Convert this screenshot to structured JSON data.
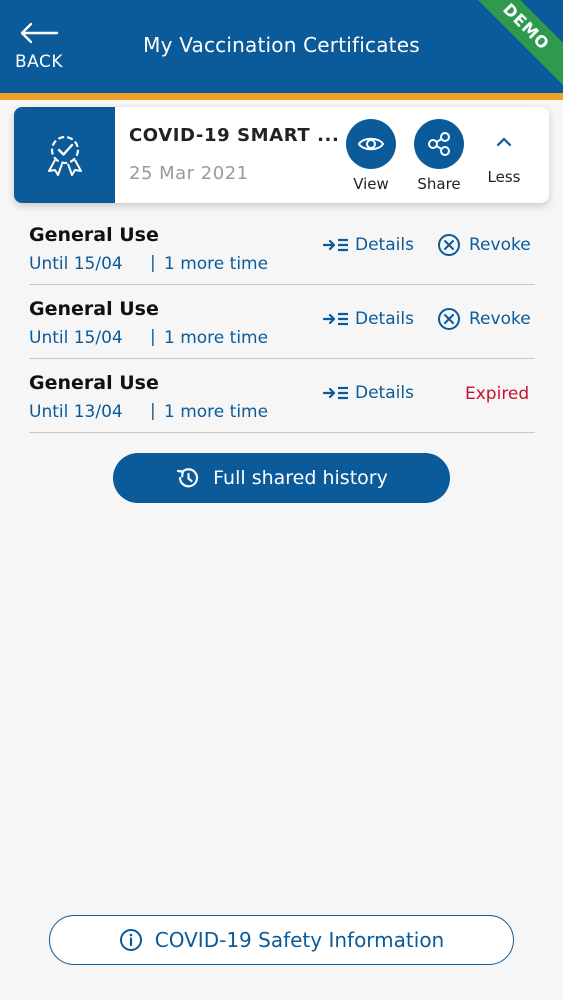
{
  "header": {
    "back_label": "BACK",
    "title": "My Vaccination Certificates",
    "ribbon": "DEMO"
  },
  "colors": {
    "primary": "#0b5a9a",
    "accent_bar": "#f0a125",
    "ribbon": "#2f9a4e",
    "expired": "#c8102e"
  },
  "certificate": {
    "name": "COVID-19 SMART ...",
    "date": "25 Mar 2021",
    "badge_icon": "certificate-badge-icon",
    "actions": {
      "view_label": "View",
      "share_label": "Share",
      "less_label": "Less"
    }
  },
  "shares": [
    {
      "purpose": "General Use",
      "until": "Until 15/04",
      "separator": "|",
      "uses": "1 more time",
      "details_label": "Details",
      "revoke_label": "Revoke",
      "status": ""
    },
    {
      "purpose": "General Use",
      "until": "Until 15/04",
      "separator": "|",
      "uses": "1 more time",
      "details_label": "Details",
      "revoke_label": "Revoke",
      "status": ""
    },
    {
      "purpose": "General Use",
      "until": "Until 13/04",
      "separator": "|",
      "uses": "1 more time",
      "details_label": "Details",
      "revoke_label": "",
      "status": "Expired"
    }
  ],
  "history_button_label": "Full shared history",
  "safety_button_label": "COVID-19 Safety Information"
}
